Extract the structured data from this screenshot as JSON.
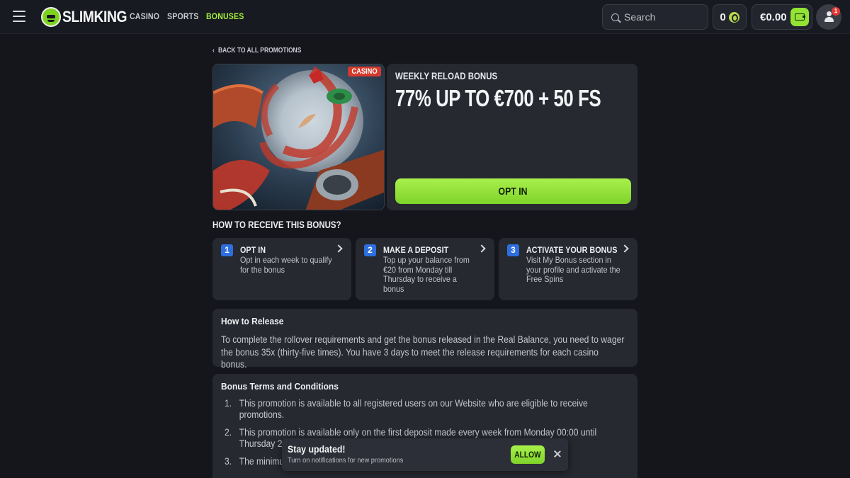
{
  "header": {
    "logo_text": "SLIMKING",
    "nav": [
      {
        "label": "CASINO"
      },
      {
        "label": "SPORTS"
      },
      {
        "label": "BONUSES"
      }
    ],
    "search_placeholder": "Search",
    "coins": "0",
    "balance": "€0.00",
    "notifications": "1"
  },
  "colors": {
    "accent_green": "#93e335",
    "step_blue": "#2e6fe0",
    "tag_red": "#d63a2c",
    "background": "#14161c",
    "card": "#262930"
  },
  "back_link": "BACK TO ALL PROMOTIONS",
  "promo": {
    "tag": "CASINO",
    "subtitle": "WEEKLY RELOAD BONUS",
    "title": "77% UP TO €700 + 50 FS",
    "button": "OPT IN"
  },
  "how_to": {
    "title": "HOW TO RECEIVE THIS BONUS?",
    "steps": [
      {
        "num": "1",
        "title": "OPT IN",
        "desc": "Opt in each week to qualify for the bonus"
      },
      {
        "num": "2",
        "title": "MAKE A DEPOSIT",
        "desc": "Top up your balance from €20 from Monday till Thursday to receive a bonus"
      },
      {
        "num": "3",
        "title": "ACTIVATE YOUR BONUS",
        "desc": "Visit My Bonus section in your profile and activate the Free Spins"
      }
    ]
  },
  "release": {
    "title": "How to Release",
    "text": "To complete the rollover requirements and get the bonus released in the Real Balance, you need to wager the bonus 35x (thirty-five times). You have 3 days to meet the release requirements for each casino bonus."
  },
  "terms": {
    "title": "Bonus Terms and Conditions",
    "items": [
      {
        "num": "1.",
        "text": "This promotion is available to all registered users on our Website who are eligible to receive promotions."
      },
      {
        "num": "2.",
        "text": "This promotion is available only on the first deposit made every week from Monday 00:00 until Thursday 2"
      },
      {
        "num": "3.",
        "text": "The minimu"
      }
    ]
  },
  "toast": {
    "title": "Stay updated!",
    "text": "Turn on notifications for new promotions",
    "button": "ALLOW"
  }
}
